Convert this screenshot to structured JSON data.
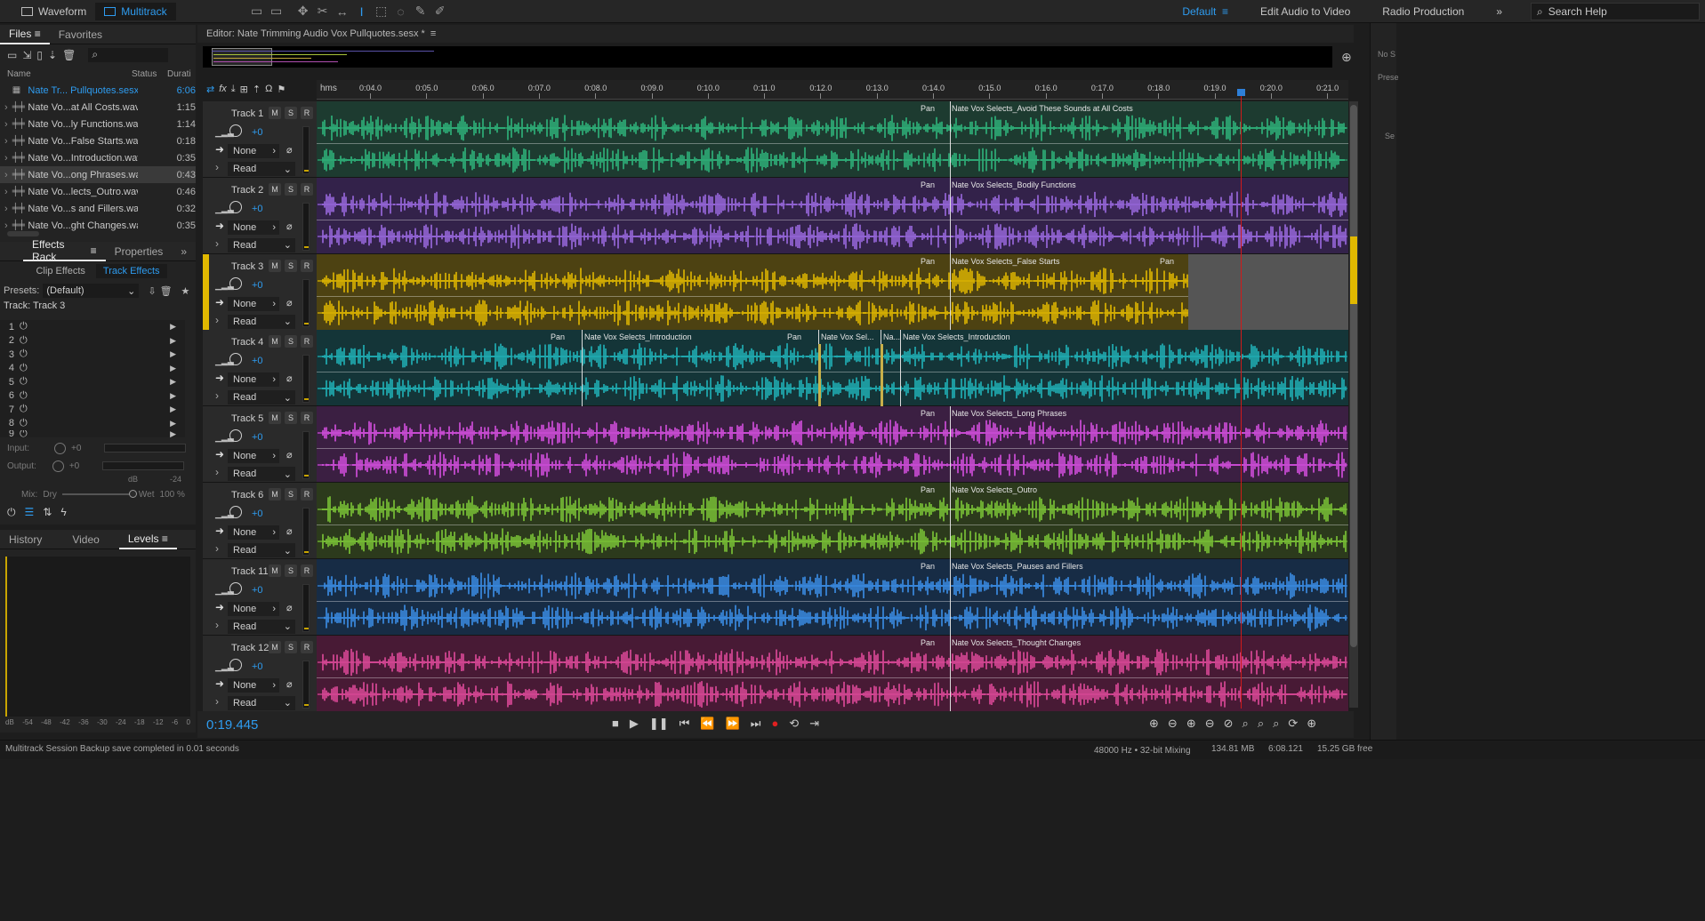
{
  "topbar": {
    "modes": [
      {
        "label": "Waveform"
      },
      {
        "label": "Multitrack"
      }
    ],
    "workspaces": [
      "Default",
      "Edit Audio to Video",
      "Radio Production"
    ],
    "search_placeholder": "Search Help"
  },
  "files_panel": {
    "tabs": [
      "Files",
      "Favorites"
    ],
    "columns": {
      "name": "Name",
      "status": "Status",
      "duration": "Durati"
    },
    "files": [
      {
        "name": "Nate Tr... Pullquotes.sesx *",
        "duration": "6:06",
        "type": "session"
      },
      {
        "name": "Nate Vo...at All Costs.wav",
        "duration": "1:15",
        "type": "audio"
      },
      {
        "name": "Nate Vo...ly Functions.wav",
        "duration": "1:14",
        "type": "audio"
      },
      {
        "name": "Nate Vo...False Starts.wav",
        "duration": "0:18",
        "type": "audio"
      },
      {
        "name": "Nate Vo...Introduction.wav",
        "duration": "0:35",
        "type": "audio"
      },
      {
        "name": "Nate Vo...ong Phrases.wav",
        "duration": "0:43",
        "type": "audio"
      },
      {
        "name": "Nate Vo...lects_Outro.wav",
        "duration": "0:46",
        "type": "audio"
      },
      {
        "name": "Nate Vo...s and Fillers.wav",
        "duration": "0:32",
        "type": "audio"
      },
      {
        "name": "Nate Vo...ght Changes.wav",
        "duration": "0:35",
        "type": "audio"
      }
    ]
  },
  "effects_panel": {
    "tabs": [
      "Effects Rack",
      "Properties"
    ],
    "subtabs": [
      "Clip Effects",
      "Track Effects"
    ],
    "presets_label": "Presets:",
    "preset_value": "(Default)",
    "track_label": "Track: Track 3",
    "slots": [
      "1",
      "2",
      "3",
      "4",
      "5",
      "6",
      "7",
      "8",
      "9"
    ],
    "input_label": "Input:",
    "output_label": "Output:",
    "input_value": "+0",
    "output_value": "+0",
    "mix_label": "Mix:",
    "dry_label": "Dry",
    "wet_label": "Wet",
    "wet_value": "100 %",
    "db_scale": [
      "dB",
      "-54",
      "-48",
      "-42",
      "-36",
      "-30",
      "-24",
      "-18",
      "-12",
      "-6",
      "0"
    ],
    "meter_scale": [
      "dB",
      "-24",
      "0"
    ]
  },
  "bottom_panel": {
    "tabs": [
      "History",
      "Video",
      "Levels"
    ]
  },
  "editor": {
    "title": "Editor: Nate Trimming Audio Vox Pullquotes.sesx *",
    "ruler_unit": "hms",
    "ruler_ticks": [
      "0:04.0",
      "0:05.0",
      "0:06.0",
      "0:07.0",
      "0:08.0",
      "0:09.0",
      "0:10.0",
      "0:11.0",
      "0:12.0",
      "0:13.0",
      "0:14.0",
      "0:15.0",
      "0:16.0",
      "0:17.0",
      "0:18.0",
      "0:19.0",
      "0:20.0",
      "0:21.0"
    ],
    "playhead_time": "0:19.445"
  },
  "tracks": [
    {
      "name": "Track 1",
      "volume": "+0",
      "input": "None",
      "mode": "Read",
      "color": "#2fb57c",
      "lane_bg": "#1d3b30",
      "header_accent": false,
      "clips": [
        {
          "label": "Nate Vox Selects_Avoid These Sounds at All Costs",
          "pan": "Pan"
        }
      ]
    },
    {
      "name": "Track 2",
      "volume": "+0",
      "input": "None",
      "mode": "Read",
      "color": "#9b6ae0",
      "lane_bg": "#33224a",
      "header_accent": false,
      "clips": [
        {
          "label": "Nate Vox Selects_Bodily Functions",
          "pan": "Pan"
        }
      ]
    },
    {
      "name": "Track 3",
      "volume": "+0",
      "input": "None",
      "mode": "Read",
      "color": "#e1b800",
      "lane_bg": "#4d4212",
      "header_accent": true,
      "clips": [
        {
          "label": "Nate Vox Selects_False Starts",
          "pan": "Pan"
        }
      ]
    },
    {
      "name": "Track 4",
      "volume": "+0",
      "input": "None",
      "mode": "Read",
      "color": "#20b3b9",
      "lane_bg": "#143538",
      "header_accent": false,
      "clips": [
        {
          "label": "Nate Vox Selects_Introduction",
          "pan": "Pan"
        },
        {
          "label": "Nate Vox Sel...",
          "pan": "Pan"
        },
        {
          "label": "Na...",
          "pan": ""
        },
        {
          "label": "Nate Vox Selects_Introduction",
          "pan": ""
        }
      ]
    },
    {
      "name": "Track 5",
      "volume": "+0",
      "input": "None",
      "mode": "Read",
      "color": "#d54fe0",
      "lane_bg": "#3b1f42",
      "header_accent": false,
      "clips": [
        {
          "label": "Nate Vox Selects_Long Phrases",
          "pan": "Pan"
        }
      ]
    },
    {
      "name": "Track 6",
      "volume": "+0",
      "input": "None",
      "mode": "Read",
      "color": "#7cc737",
      "lane_bg": "#2c3a1c",
      "header_accent": false,
      "clips": [
        {
          "label": "Nate Vox Selects_Outro",
          "pan": "Pan"
        }
      ]
    },
    {
      "name": "Track 11",
      "volume": "+0",
      "input": "None",
      "mode": "Read",
      "color": "#3b8fe8",
      "lane_bg": "#172c45",
      "header_accent": false,
      "clips": [
        {
          "label": "Nate Vox Selects_Pauses and Fillers",
          "pan": "Pan"
        }
      ]
    },
    {
      "name": "Track 12",
      "volume": "+0",
      "input": "None",
      "mode": "Read",
      "color": "#e04a9a",
      "lane_bg": "#481a35",
      "header_accent": false,
      "clips": [
        {
          "label": "Nate Vox Selects_Thought Changes",
          "pan": "Pan"
        }
      ]
    }
  ],
  "track_buttons": [
    "M",
    "S",
    "R"
  ],
  "status_bar": {
    "message": "Multitrack Session Backup save completed in 0.01 seconds",
    "sample_rate": "48000 Hz • 32-bit Mixing",
    "memory": "134.81 MB",
    "duration": "6:08.121",
    "free_space": "15.25 GB free"
  },
  "right_panel": {
    "labels": [
      "No S",
      "Prese",
      "Se"
    ]
  },
  "colors": {
    "accent": "#2e9cf0",
    "playhead": "#d11a1a"
  }
}
